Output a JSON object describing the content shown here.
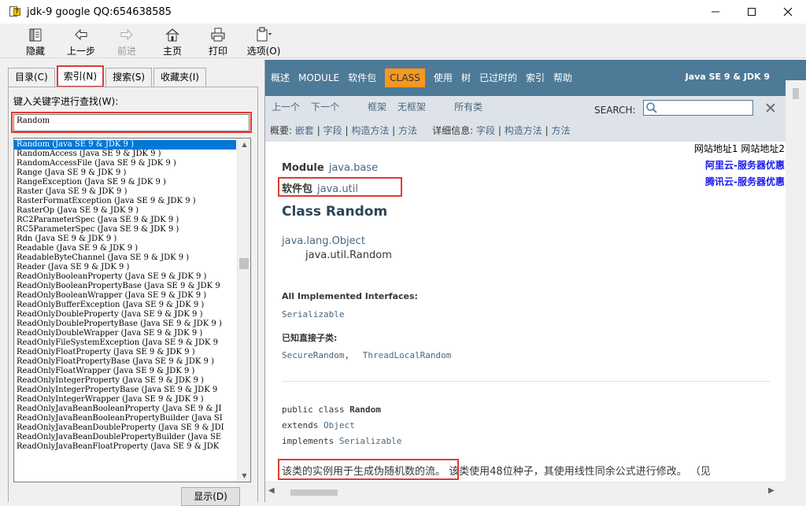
{
  "window": {
    "title": "jdk-9 google QQ:654638585",
    "icon": "help-book-icon",
    "controls": [
      "minimize-icon",
      "maximize-icon",
      "close-icon"
    ]
  },
  "toolbar": {
    "hide": "隐藏",
    "back": "上一步",
    "forward": "前进",
    "home": "主页",
    "print": "打印",
    "options": "选项(O)"
  },
  "left": {
    "tabs": [
      "目录(C)",
      "索引(N)",
      "搜索(S)",
      "收藏夹(I)"
    ],
    "active_tab": "索引(N)",
    "keyword_label": "键入关键字进行查找(W):",
    "keyword_value": "Random",
    "index_items": [
      "Random (Java SE 9 & JDK 9 )",
      "RandomAccess (Java SE 9 & JDK 9 )",
      "RandomAccessFile (Java SE 9 & JDK 9 )",
      "Range (Java SE 9 & JDK 9 )",
      "RangeException (Java SE 9 & JDK 9 )",
      "Raster (Java SE 9 & JDK 9 )",
      "RasterFormatException (Java SE 9 & JDK 9 )",
      "RasterOp (Java SE 9 & JDK 9 )",
      "RC2ParameterSpec (Java SE 9 & JDK 9 )",
      "RC5ParameterSpec (Java SE 9 & JDK 9 )",
      "Rdn (Java SE 9 & JDK 9 )",
      "Readable (Java SE 9 & JDK 9 )",
      "ReadableByteChannel (Java SE 9 & JDK 9 )",
      "Reader (Java SE 9 & JDK 9 )",
      "ReadOnlyBooleanProperty (Java SE 9 & JDK 9 )",
      "ReadOnlyBooleanPropertyBase (Java SE 9 & JDK 9",
      "ReadOnlyBooleanWrapper (Java SE 9 & JDK 9 )",
      "ReadOnlyBufferException (Java SE 9 & JDK 9 )",
      "ReadOnlyDoubleProperty (Java SE 9 & JDK 9 )",
      "ReadOnlyDoublePropertyBase (Java SE 9 & JDK 9 )",
      "ReadOnlyDoubleWrapper (Java SE 9 & JDK 9 )",
      "ReadOnlyFileSystemException (Java SE 9 & JDK 9",
      "ReadOnlyFloatProperty (Java SE 9 & JDK 9 )",
      "ReadOnlyFloatPropertyBase (Java SE 9 & JDK 9 )",
      "ReadOnlyFloatWrapper (Java SE 9 & JDK 9 )",
      "ReadOnlyIntegerProperty (Java SE 9 & JDK 9 )",
      "ReadOnlyIntegerPropertyBase (Java SE 9 & JDK 9",
      "ReadOnlyIntegerWrapper (Java SE 9 & JDK 9 )",
      "ReadOnlyJavaBeanBooleanProperty (Java SE 9 & JI",
      "ReadOnlyJavaBeanBooleanPropertyBuilder (Java SI",
      "ReadOnlyJavaBeanDoubleProperty (Java SE 9 & JDI",
      "ReadOnlyJavaBeanDoublePropertyBuilder (Java SE",
      "ReadOnlyJavaBeanFloatProperty (Java SE 9 & JDK"
    ],
    "selected_index": 0,
    "show_button": "显示(D)"
  },
  "nav": {
    "items": [
      "概述",
      "MODULE",
      "软件包",
      "CLASS",
      "使用",
      "树",
      "已过时的",
      "索引",
      "帮助"
    ],
    "active": "CLASS",
    "brand": "Java SE 9 & JDK 9",
    "prev": "上一个",
    "next": "下一个",
    "frames": "框架",
    "no_frames": "无框架",
    "all_classes": "所有类",
    "search_label": "SEARCH:",
    "search_value": "",
    "summary_label": "概要:",
    "summary_links": [
      "嵌套",
      "字段",
      "构造方法",
      "方法"
    ],
    "detail_label": "详细信息:",
    "detail_links": [
      "字段",
      "构造方法",
      "方法"
    ],
    "sep": "|"
  },
  "content": {
    "ad_links": "网站地址1 网站地址2",
    "ad1": "阿里云-服务器优惠",
    "ad2": "腾讯云-服务器优惠",
    "module_label": "Module",
    "module_value": "java.base",
    "package_label": "软件包",
    "package_value": "java.util",
    "class_title": "Class Random",
    "inherit_parent": "java.lang.Object",
    "inherit_child": "java.util.Random",
    "impl_heading": "All Implemented Interfaces:",
    "impl_value": "Serializable",
    "subclass_heading": "已知直接子类:",
    "subclass1": "SecureRandom",
    "subclass_sep": ",",
    "subclass2": "ThreadLocalRandom",
    "code_public": "public class ",
    "code_classname": "Random",
    "code_extends": "extends ",
    "code_object": "Object",
    "code_implements": "implements ",
    "code_serializable": "Serializable",
    "desc_highlight": "该类的实例用于生成伪随机数的流。",
    "desc_rest": "该类使用48位种子，其使用线性同余公式进行修改。 （见"
  },
  "colors": {
    "nav_bg": "#4d7a97",
    "nav_active": "#f8981d",
    "subnav_bg": "#dee3e9",
    "link": "#4a6782",
    "highlight_box": "#e53935",
    "list_selection": "#0078d7"
  }
}
